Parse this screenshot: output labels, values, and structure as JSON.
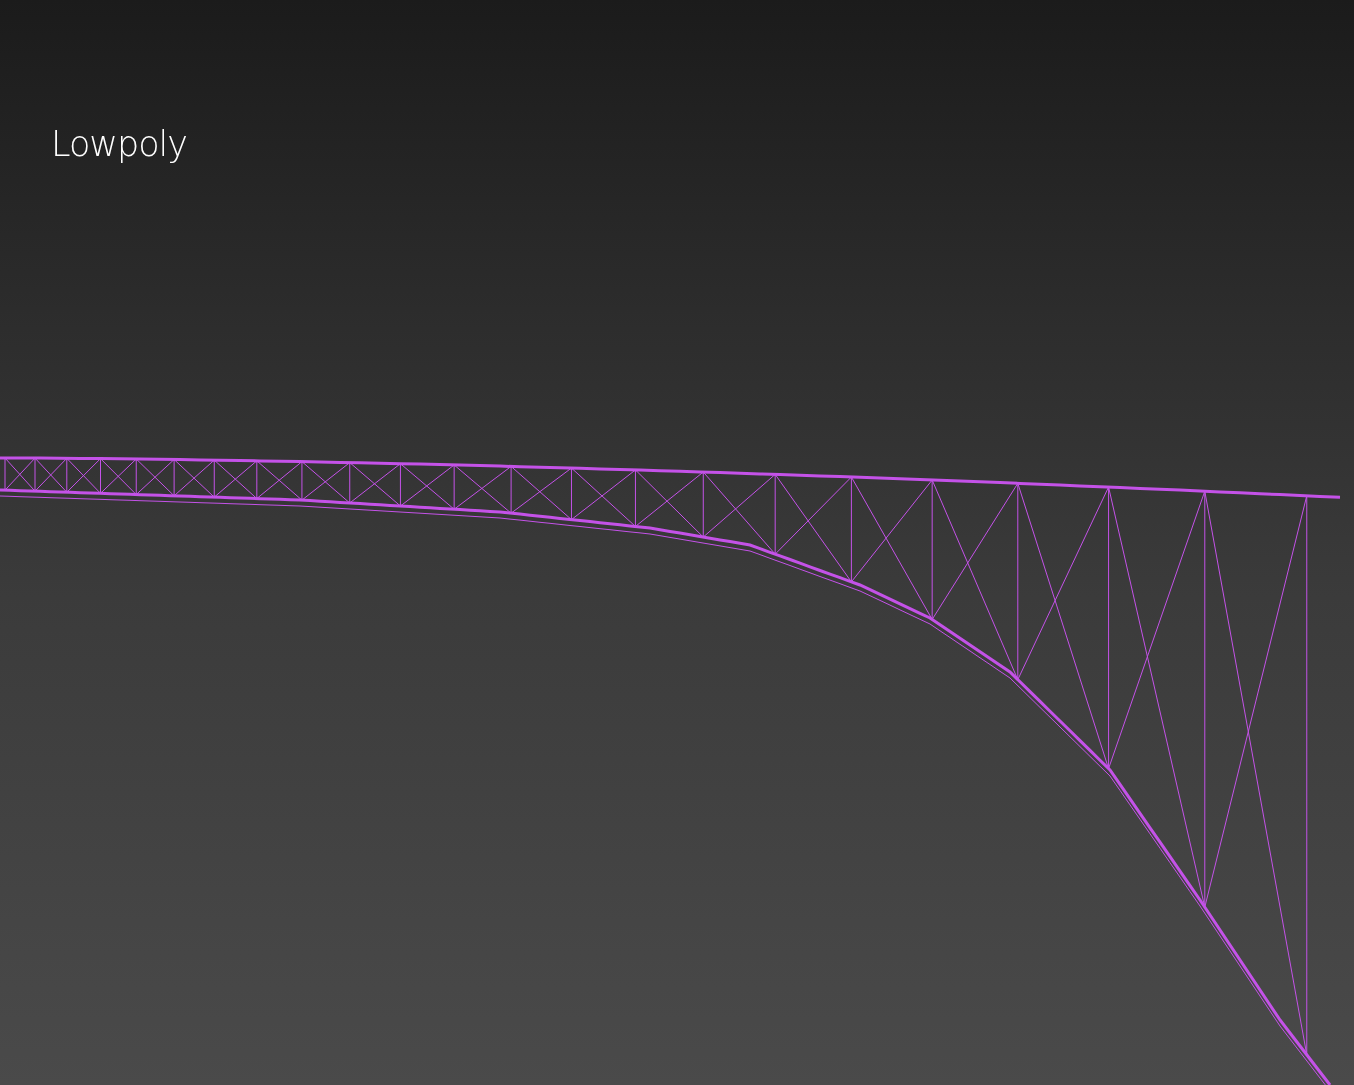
{
  "viewport": {
    "label": "Lowpoly"
  }
}
